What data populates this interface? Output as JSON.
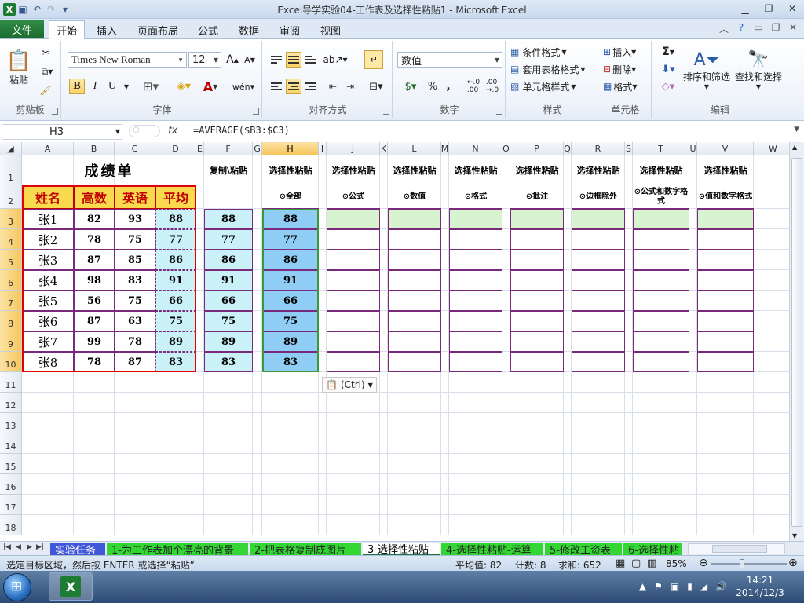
{
  "window": {
    "title": "Excel导学实验04-工作表及选择性粘贴1  -  Microsoft Excel",
    "minimize_icon": "minimize-icon",
    "restore_icon": "restore-icon",
    "close_icon": "close-icon"
  },
  "ribbon_tabs": [
    "文件",
    "开始",
    "插入",
    "页面布局",
    "公式",
    "数据",
    "审阅",
    "视图"
  ],
  "active_tab": "开始",
  "ribbon": {
    "clipboard": {
      "label": "剪贴板",
      "paste": "粘贴"
    },
    "font": {
      "label": "字体",
      "font_name": "Times New Roman",
      "font_size": "12",
      "bold": "B",
      "italic": "I",
      "underline": "U",
      "font_color_letter": "A",
      "phonetic": "wén"
    },
    "alignment": {
      "label": "对齐方式"
    },
    "number": {
      "label": "数字",
      "format": "数值",
      "percent": "%",
      "comma": ","
    },
    "styles": {
      "label": "样式",
      "conditional": "条件格式",
      "table_style": "套用表格格式",
      "cell_style": "单元格样式"
    },
    "cells": {
      "label": "单元格",
      "insert": "插入",
      "delete": "删除",
      "format": "格式"
    },
    "editing": {
      "label": "编辑",
      "sum": "Σ",
      "sort": "排序和筛选",
      "find": "查找和选择"
    }
  },
  "formula_bar": {
    "name_box": "H3",
    "fx": "fx",
    "formula": "=AVERAGE($B3:$C3)"
  },
  "columns": [
    "A",
    "B",
    "C",
    "D",
    "E",
    "F",
    "G",
    "H",
    "I",
    "J",
    "K",
    "L",
    "M",
    "N",
    "O",
    "P",
    "Q",
    "R",
    "S",
    "T",
    "U",
    "V",
    "W"
  ],
  "rows": [
    "1",
    "2",
    "3",
    "4",
    "5",
    "6",
    "7",
    "8",
    "9",
    "10",
    "11",
    "12",
    "13",
    "14",
    "15",
    "16",
    "17",
    "18"
  ],
  "sheet": {
    "title": "成绩单",
    "headers": [
      "姓名",
      "高数",
      "英语",
      "平均"
    ],
    "students": [
      {
        "name": "张1",
        "math": "82",
        "english": "93",
        "avg": "88"
      },
      {
        "name": "张2",
        "math": "78",
        "english": "75",
        "avg": "77"
      },
      {
        "name": "张3",
        "math": "87",
        "english": "85",
        "avg": "86"
      },
      {
        "name": "张4",
        "math": "98",
        "english": "83",
        "avg": "91"
      },
      {
        "name": "张5",
        "math": "56",
        "english": "75",
        "avg": "66"
      },
      {
        "name": "张6",
        "math": "87",
        "english": "63",
        "avg": "75"
      },
      {
        "name": "张7",
        "math": "99",
        "english": "78",
        "avg": "89"
      },
      {
        "name": "张8",
        "math": "78",
        "english": "87",
        "avg": "83"
      }
    ],
    "copy_header": "复制\\粘贴",
    "paste_headers": [
      "选择性粘贴",
      "选择性粘贴",
      "选择性粘贴",
      "选择性粘贴",
      "选择性粘贴",
      "选择性粘贴",
      "选择性粘贴",
      "选择性粘贴"
    ],
    "paste_options": [
      "⊙全部",
      "⊙公式",
      "⊙数值",
      "⊙格式",
      "⊙批注",
      "⊙边框除外",
      "⊙公式和数字格式",
      "⊙值和数字格式"
    ],
    "paste_ctrl": "(Ctrl)"
  },
  "sheet_tabs": [
    {
      "label": "实验任务",
      "style": "blue"
    },
    {
      "label": "1-为工作表加个漂亮的背景",
      "style": "green"
    },
    {
      "label": "2-把表格复制成图片",
      "style": "green"
    },
    {
      "label": "3-选择性粘贴",
      "style": "active"
    },
    {
      "label": "4-选择性粘贴-运算",
      "style": "green"
    },
    {
      "label": "5-修改工资表",
      "style": "green"
    },
    {
      "label": "6-选择性粘",
      "style": "green"
    }
  ],
  "status": {
    "message": "选定目标区域，然后按 ENTER 或选择“粘贴”",
    "average": "平均值: 82",
    "count": "计数: 8",
    "sum": "求和: 652",
    "zoom": "85%"
  },
  "taskbar": {
    "time": "14:21",
    "date": "2014/12/3"
  },
  "colors": {
    "header_fill": "#f9d94d",
    "header_text": "#c00000",
    "copy_fill": "#c9f1f7",
    "selected_fill": "#8fcdf5",
    "green_fill": "#d7f3d0",
    "border": "#7a2a7a"
  }
}
